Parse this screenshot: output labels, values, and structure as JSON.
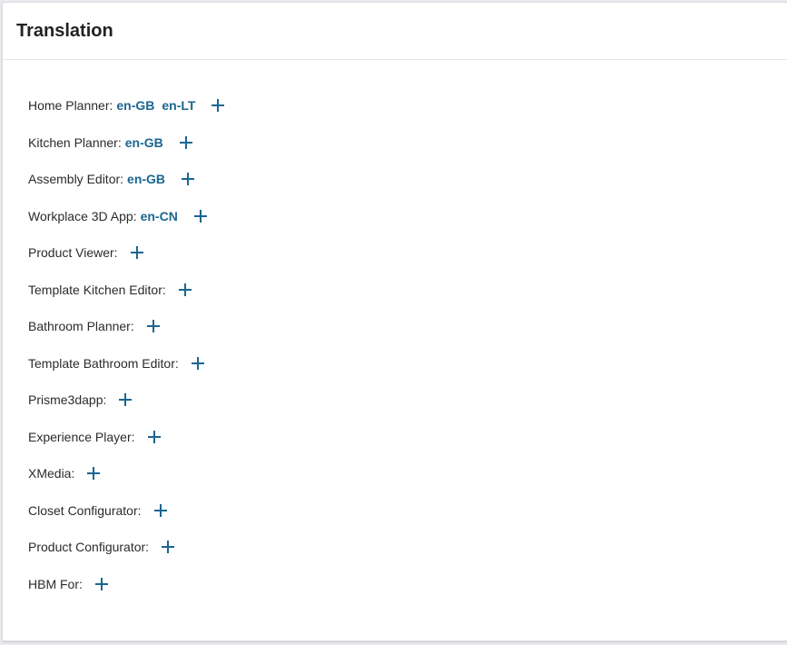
{
  "header": {
    "title": "Translation"
  },
  "accent_color": "#1a6690",
  "add_icon": "plus-icon",
  "apps": [
    {
      "name": "Home Planner:",
      "languages": [
        "en-GB",
        "en-LT"
      ]
    },
    {
      "name": "Kitchen Planner:",
      "languages": [
        "en-GB"
      ]
    },
    {
      "name": "Assembly Editor:",
      "languages": [
        "en-GB"
      ]
    },
    {
      "name": "Workplace 3D App:",
      "languages": [
        "en-CN"
      ]
    },
    {
      "name": "Product Viewer:",
      "languages": []
    },
    {
      "name": "Template Kitchen Editor:",
      "languages": []
    },
    {
      "name": "Bathroom Planner:",
      "languages": []
    },
    {
      "name": "Template Bathroom Editor:",
      "languages": []
    },
    {
      "name": "Prisme3dapp:",
      "languages": []
    },
    {
      "name": "Experience Player:",
      "languages": []
    },
    {
      "name": "XMedia:",
      "languages": []
    },
    {
      "name": "Closet Configurator:",
      "languages": []
    },
    {
      "name": "Product Configurator:",
      "languages": []
    },
    {
      "name": "HBM For:",
      "languages": []
    }
  ]
}
